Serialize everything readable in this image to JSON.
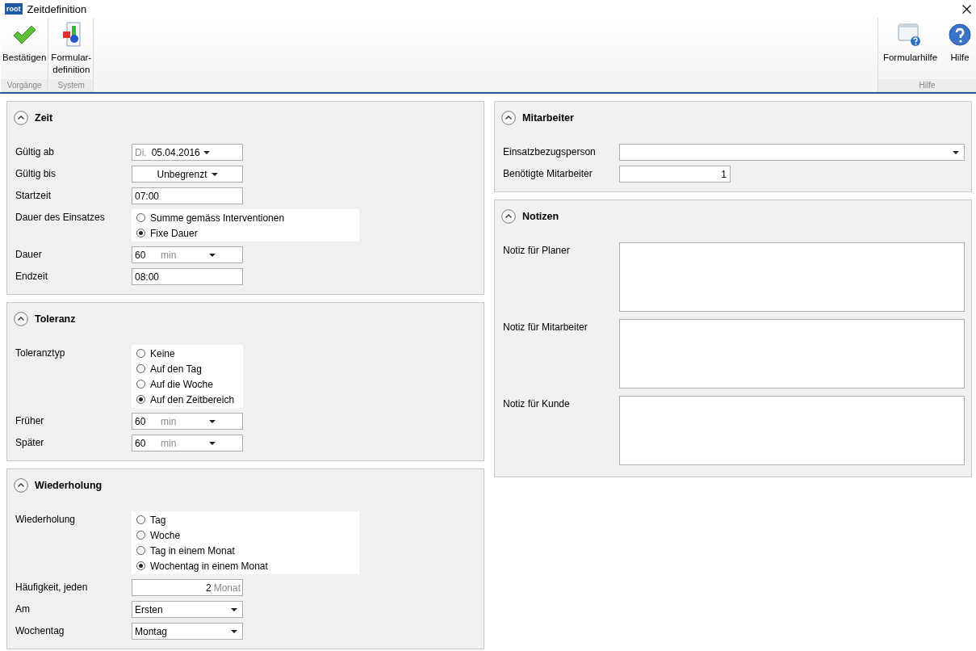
{
  "window": {
    "app_logo": "root",
    "title": "Zeitdefinition"
  },
  "ribbon": {
    "groups": [
      {
        "label": "Vorgänge",
        "buttons": [
          {
            "label": "Bestätigen"
          }
        ]
      },
      {
        "label": "System",
        "buttons": [
          {
            "label": "Formular-\ndefinition"
          }
        ]
      },
      {
        "label": "Hilfe",
        "buttons": [
          {
            "label": "Formularhilfe"
          },
          {
            "label": "Hilfe"
          }
        ]
      }
    ]
  },
  "left_column": [
    {
      "title": "Zeit",
      "expanded": true,
      "rows": [
        {
          "kind": "date",
          "label": "Gültig ab",
          "prefix": "Di.",
          "value": "05.04.2016"
        },
        {
          "kind": "dropdown",
          "label": "Gültig bis",
          "value": "Unbegrenzt"
        },
        {
          "kind": "text",
          "label": "Startzeit",
          "value": "07:00"
        },
        {
          "kind": "radio",
          "label": "Dauer des Einsatzes",
          "wide": true,
          "options": [
            {
              "label": "Summe gemäss Interventionen",
              "selected": false
            },
            {
              "label": "Fixe Dauer",
              "selected": true
            }
          ]
        },
        {
          "kind": "duration",
          "label": "Dauer",
          "value": "60",
          "unit": "min"
        },
        {
          "kind": "text",
          "label": "Endzeit",
          "value": "08:00"
        }
      ]
    },
    {
      "title": "Toleranz",
      "expanded": true,
      "rows": [
        {
          "kind": "radio",
          "label": "Toleranztyp",
          "wide": false,
          "options": [
            {
              "label": "Keine",
              "selected": false
            },
            {
              "label": "Auf den Tag",
              "selected": false
            },
            {
              "label": "Auf die Woche",
              "selected": false
            },
            {
              "label": "Auf den Zeitbereich",
              "selected": true
            }
          ]
        },
        {
          "kind": "duration",
          "label": "Früher",
          "value": "60",
          "unit": "min"
        },
        {
          "kind": "duration",
          "label": "Später",
          "value": "60",
          "unit": "min"
        }
      ]
    },
    {
      "title": "Wiederholung",
      "expanded": true,
      "rows": [
        {
          "kind": "radio",
          "label": "Wiederholung",
          "wide": true,
          "options": [
            {
              "label": "Tag",
              "selected": false
            },
            {
              "label": "Woche",
              "selected": false
            },
            {
              "label": "Tag in einem Monat",
              "selected": false
            },
            {
              "label": "Wochentag in einem Monat",
              "selected": true
            }
          ]
        },
        {
          "kind": "number",
          "label": "Häufigkeit, jeden",
          "value": "2",
          "unit": "Monat"
        },
        {
          "kind": "select",
          "label": "Am",
          "value": "Ersten"
        },
        {
          "kind": "select",
          "label": "Wochentag",
          "value": "Montag"
        }
      ]
    }
  ],
  "right_column": [
    {
      "title": "Mitarbeiter",
      "expanded": true,
      "rows": [
        {
          "kind": "combo",
          "label": "Einsatzbezugsperson"
        },
        {
          "kind": "number",
          "label": "Benötigte Mitarbeiter",
          "value": "1"
        }
      ]
    },
    {
      "title": "Notizen",
      "expanded": true,
      "rows": [
        {
          "kind": "textarea",
          "label": "Notiz für Planer"
        },
        {
          "kind": "textarea",
          "label": "Notiz für Mitarbeiter"
        },
        {
          "kind": "textarea",
          "label": "Notiz für Kunde"
        }
      ]
    }
  ]
}
